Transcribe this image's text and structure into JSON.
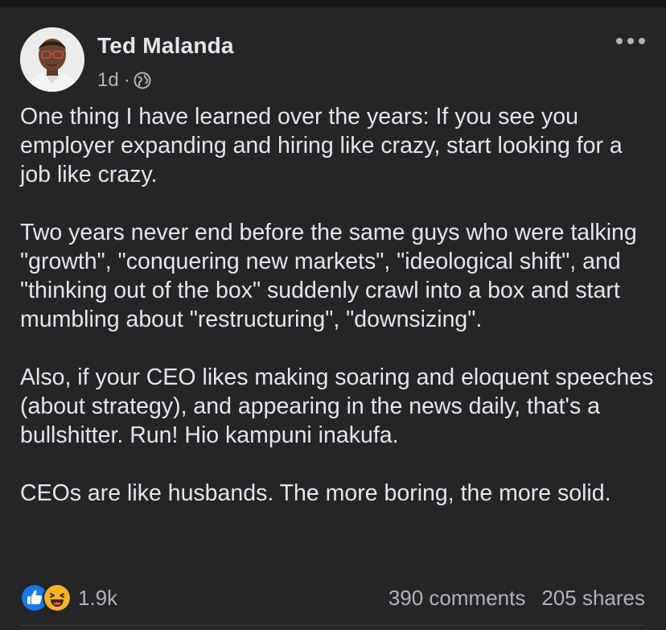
{
  "post": {
    "author": "Ted Malanda",
    "time": "1d",
    "separator": "·",
    "privacy_icon": "globe-icon",
    "more_icon": "more-horizontal-icon",
    "paragraphs": [
      "One thing I have learned over the years: If you see you employer expanding and hiring like crazy, start looking for a job like crazy.",
      "Two years never end before the same guys who were talking \"growth\", \"conquering new markets\", \"ideological shift\", and \"thinking out of the box\" suddenly crawl into a box and start mumbling about \"restructuring\", \"downsizing\".",
      "Also, if your CEO likes making soaring and eloquent speeches (about strategy), and appearing in the news daily, that's a bullshitter. Run! Hio kampuni inakufa.",
      "CEOs are like husbands. The more boring, the more solid."
    ],
    "reactions": {
      "icons": [
        "like-icon",
        "haha-icon"
      ],
      "count": "1.9k"
    },
    "comments": "390 comments",
    "shares": "205 shares"
  },
  "colors": {
    "background": "#242526",
    "text": "#e4e6eb",
    "secondary_text": "#b0b3b8",
    "like_blue": "#1877f2",
    "haha_yellow": "#f7b125"
  }
}
